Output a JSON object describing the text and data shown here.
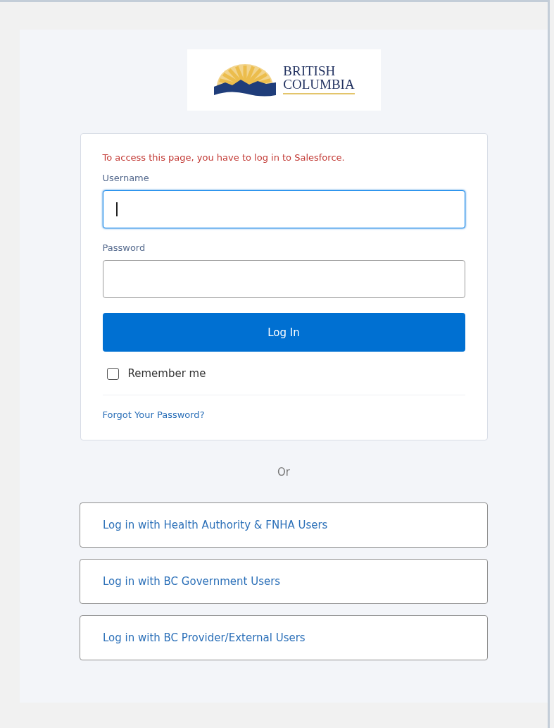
{
  "logo": {
    "lines": [
      "BRITISH",
      "COLUMBIA"
    ]
  },
  "login_card": {
    "message": "To access this page, you have to log in to Salesforce.",
    "fields": [
      {
        "label": "Username",
        "focused": true
      },
      {
        "label": "Password",
        "focused": false
      }
    ],
    "login_button": "Log In",
    "remember_me": {
      "label": "Remember me",
      "checked": false
    },
    "forgot_link": "Forgot Your Password?"
  },
  "separator": "Or",
  "sso_buttons": [
    "Log in with Health Authority & FNHA Users",
    "Log in with BC Government Users",
    "Log in with BC Provider/External Users"
  ]
}
